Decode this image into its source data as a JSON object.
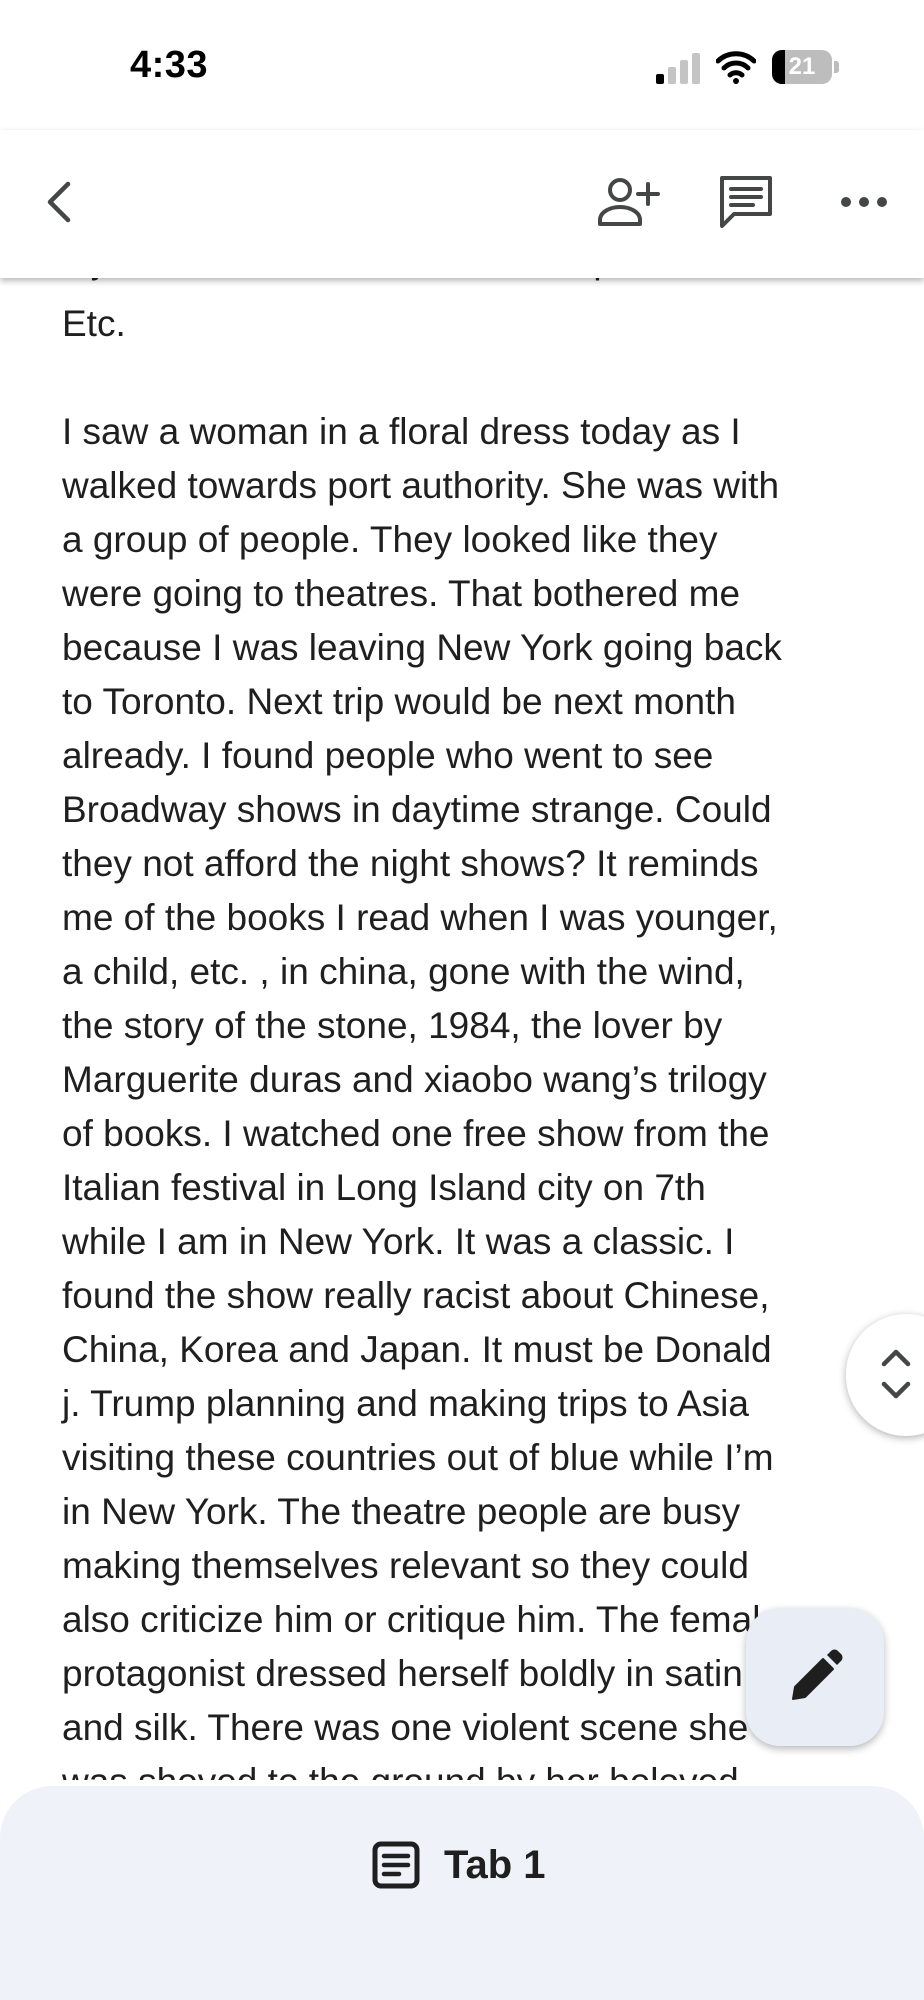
{
  "status_bar": {
    "time": "4:33",
    "battery_level": "21",
    "battery_fraction": 0.21,
    "icons": [
      "signal-icon",
      "wifi-icon",
      "battery-icon"
    ]
  },
  "toolbar": {
    "icons": [
      "back-icon",
      "add-person-icon",
      "comment-icon",
      "more-icon"
    ]
  },
  "document": {
    "partial_top_line": "a job on the market? That’s the question.",
    "etc_line": "Etc.",
    "paragraph_lines": [
      "I saw a woman in a floral dress today as I",
      "walked towards port authority. She was with",
      "a group of people. They looked like they",
      "were going to theatres. That bothered me",
      "because I was leaving New York going back",
      "to Toronto. Next trip would be next month",
      "already. I found people who went to see",
      "Broadway shows in daytime strange. Could",
      "they not afford the night shows? It reminds",
      "me of the books I read when I was younger,",
      "a child, etc. , in china, gone with the wind,",
      "the story of the stone, 1984, the lover by",
      "Marguerite duras and xiaobo wang’s trilogy",
      "of books. I watched one free show from the",
      "Italian festival in Long Island city on 7th",
      "while I am in New York. It was a classic. I",
      "found the show really racist about Chinese,",
      "China, Korea and Japan. It must be Donald",
      "j. Trump planning and making trips to Asia",
      "visiting these countries out of blue while I’m",
      "in New York. The theatre people are busy",
      "making themselves relevant so they could",
      "also criticize him or critique him. The female",
      "protagonist dressed herself boldly in satin",
      "and silk. There was one violent scene she",
      "was shoved to the ground by her beloved"
    ]
  },
  "scroll_handle": {
    "icons": [
      "chevron-up-icon",
      "chevron-down-icon"
    ]
  },
  "edit_fab": {
    "icon": "pencil-icon"
  },
  "tab_bar": {
    "tab_label": "Tab 1",
    "icon": "document-icon"
  }
}
